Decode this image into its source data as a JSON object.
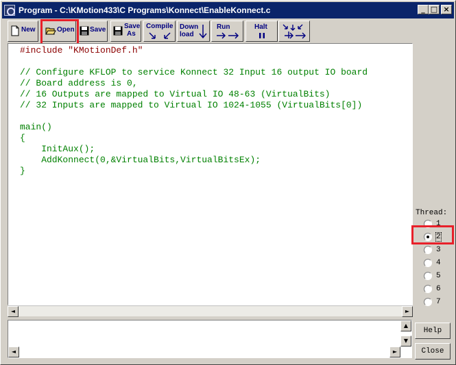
{
  "window": {
    "title": "Program - C:\\KMotion433\\C Programs\\Konnect\\EnableKonnect.c"
  },
  "title_buttons": {
    "minimize": "_",
    "maximize": "□",
    "close": "×"
  },
  "toolbar": {
    "new": "New",
    "open": "Open",
    "save": "Save",
    "save_as_1": "Save",
    "save_as_2": "As",
    "compile": "Compile",
    "download_1": "Down",
    "download_2": "load",
    "run": "Run",
    "halt": "Halt"
  },
  "editor": {
    "lines": [
      "#include \"KMotionDef.h\"",
      "",
      "// Configure KFLOP to service Konnect 32 Input 16 output IO board",
      "// Board address is 0,",
      "// 16 Outputs are mapped to Virtual IO 48-63 (VirtualBits)",
      "// 32 Inputs are mapped to Virtual IO 1024-1055 (VirtualBits[0])",
      "",
      "main()",
      "{",
      "    InitAux();",
      "    AddKonnect(0,&VirtualBits,VirtualBitsEx);",
      "}"
    ],
    "line_colors": [
      "#8b0000",
      "#000000",
      "#008000",
      "#008000",
      "#008000",
      "#008000",
      "#000000",
      "#008000",
      "#008000",
      "#008000",
      "#008000",
      "#008000"
    ]
  },
  "thread": {
    "label": "Thread:",
    "options": [
      "1",
      "2",
      "3",
      "4",
      "5",
      "6",
      "7"
    ],
    "selected": "2"
  },
  "side_buttons": {
    "help": "Help",
    "close": "Close"
  },
  "scroll_arrows": {
    "left": "◄",
    "right": "►",
    "up": "▲",
    "down": "▼"
  },
  "colors": {
    "title_bar": "#0a246a",
    "toolbar_text": "#000080",
    "highlight": "#e8202a"
  }
}
